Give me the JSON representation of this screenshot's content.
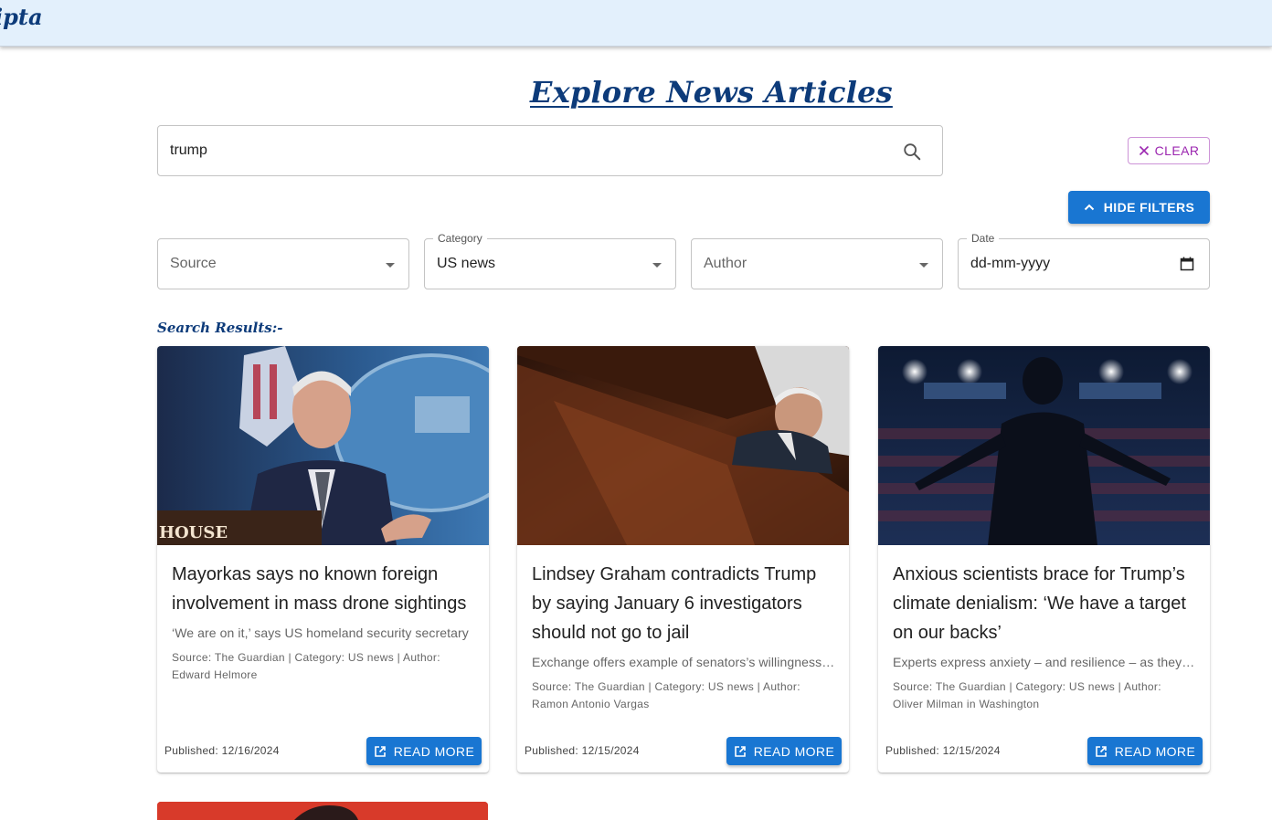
{
  "app": {
    "brand": "ipta"
  },
  "page": {
    "title": "Explore News Articles",
    "results_label": "Search Results:-"
  },
  "search": {
    "value": "trump",
    "placeholder": ""
  },
  "actions": {
    "clear_label": "CLEAR",
    "hide_filters_label": "HIDE FILTERS"
  },
  "filters": {
    "source": {
      "placeholder": "Source",
      "value": ""
    },
    "category": {
      "label": "Category",
      "value": "US news"
    },
    "author": {
      "placeholder": "Author",
      "value": ""
    },
    "date": {
      "label": "Date",
      "value": "dd-mm-yyyy"
    }
  },
  "articles": [
    {
      "title": "Mayorkas says no known foreign involvement in mass drone sightings",
      "description": "‘We are on it,’ says US homeland security secretary",
      "meta": "Source: The Guardian | Category: US news | Author: Edward Helmore",
      "published": "Published: 12/16/2024",
      "read_more": "READ MORE"
    },
    {
      "title": "Lindsey Graham contradicts Trump by saying January 6 investigators should not go to jail",
      "description": "Exchange offers example of senators’s willingness to break with Trump",
      "meta": "Source: The Guardian | Category: US news | Author: Ramon Antonio Vargas",
      "published": "Published: 12/15/2024",
      "read_more": "READ MORE"
    },
    {
      "title": "Anxious scientists brace for Trump’s climate denialism: ‘We have a target on our backs’",
      "description": "Experts express anxiety – and resilience – as they prepare for the return of Trump",
      "meta": "Source: The Guardian | Category: US news | Author: Oliver Milman in Washington",
      "published": "Published: 12/15/2024",
      "read_more": "READ MORE"
    }
  ],
  "colors": {
    "primary": "#1976d2",
    "brand": "#0d3b7a",
    "clear": "#9c27b0",
    "topbar": "#e3f0fc"
  }
}
